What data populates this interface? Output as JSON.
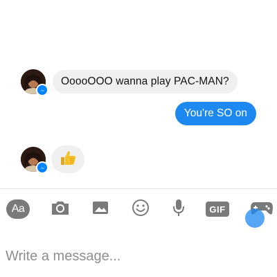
{
  "conversation": {
    "messages": [
      {
        "from": "contact",
        "type": "text",
        "text": "OoooOOO wanna play PAC-MAN?"
      },
      {
        "from": "me",
        "type": "text",
        "text": "You're SO on"
      },
      {
        "from": "contact",
        "type": "sticker",
        "icon": "thumbs-up-icon"
      }
    ]
  },
  "toolbar": {
    "aa_label": "Aa",
    "gif_label": "GIF",
    "icons": [
      "aa-icon",
      "camera-icon",
      "image-icon",
      "emoji-icon",
      "microphone-icon",
      "gif-icon",
      "gamepad-icon"
    ]
  },
  "composer": {
    "placeholder": "Write a message..."
  },
  "colors": {
    "outgoing_bubble": "#1e88f1",
    "incoming_bubble": "#f1f0f0",
    "icon_gray": "#7a7a7a",
    "messenger_blue": "#0084ff",
    "thumb_yellow": "#f5c02a"
  }
}
